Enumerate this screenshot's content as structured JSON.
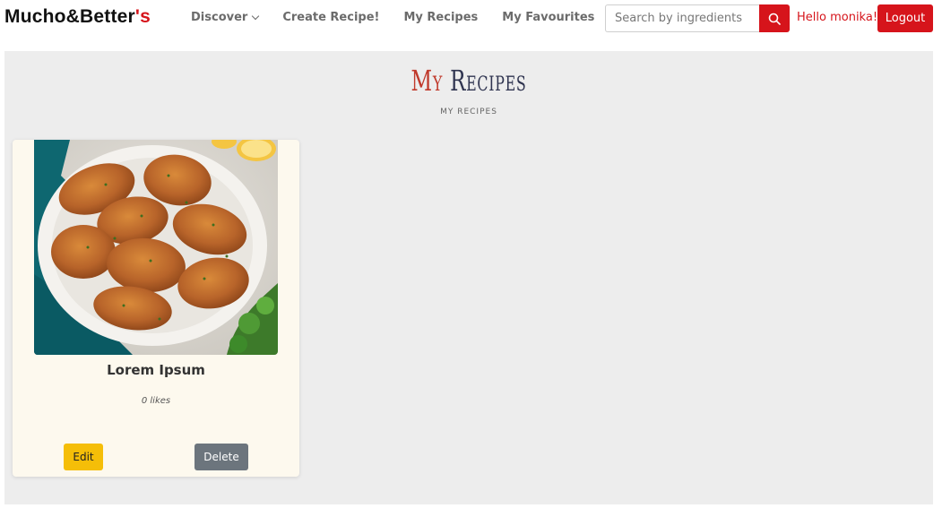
{
  "navbar": {
    "brand_main": "Mucho&Better",
    "brand_accent": "'s",
    "links": [
      {
        "label": "Discover",
        "icon": "chevron-down-icon"
      },
      {
        "label": "Create Recipe!"
      },
      {
        "label": "My Recipes"
      },
      {
        "label": "My Favourites"
      }
    ],
    "search": {
      "placeholder": "Search by ingredients",
      "value": "",
      "icon": "search-icon"
    },
    "greeting": "Hello monika!",
    "logout_label": "Logout"
  },
  "page": {
    "title_part1": "My",
    "title_part2": "Recipes",
    "subtitle": "MY RECIPES"
  },
  "recipes": [
    {
      "title": "Lorem Ipsum",
      "likes": "0 likes",
      "image": "roasted-chicken-plate-photo",
      "edit_label": "Edit",
      "delete_label": "Delete"
    }
  ],
  "colors": {
    "accent": "#d6141b",
    "background": "#ededed",
    "card": "#fdf9ee",
    "edit": "#f5be08",
    "delete": "#6c757d"
  }
}
